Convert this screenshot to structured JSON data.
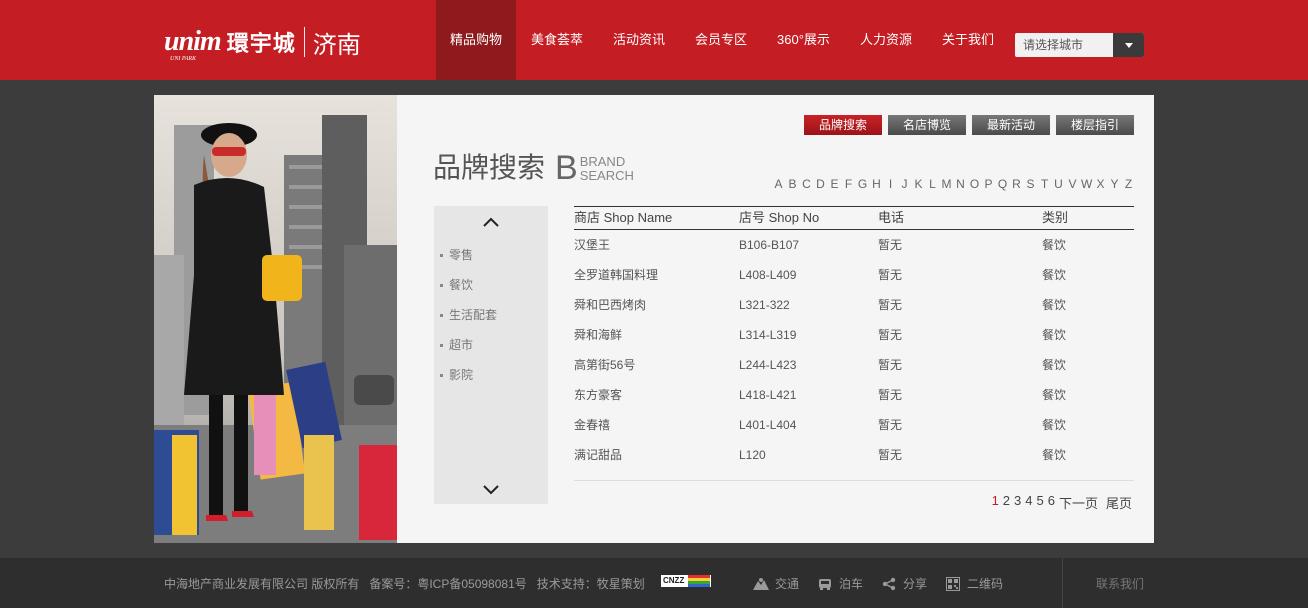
{
  "header": {
    "logo_mark": "unim",
    "logo_sub": "UNI PARK",
    "logo_brand": "環宇城",
    "logo_city": "济南",
    "nav": [
      "精品购物",
      "美食荟萃",
      "活动资讯",
      "会员专区",
      "360°展示",
      "人力资源",
      "关于我们"
    ],
    "active_nav": "精品购物",
    "city_placeholder": "请选择城市"
  },
  "tabs": [
    "品牌搜索",
    "名店博览",
    "最新活动",
    "楼层指引"
  ],
  "title": {
    "cn": "品牌搜索",
    "b": "B",
    "en_line1": "BRAND",
    "en_line2": "SEARCH"
  },
  "alphabet": [
    "A",
    "B",
    "C",
    "D",
    "E",
    "F",
    "G",
    "H",
    "I",
    "J",
    "K",
    "L",
    "M",
    "N",
    "O",
    "P",
    "Q",
    "R",
    "S",
    "T",
    "U",
    "V",
    "W",
    "X",
    "Y",
    "Z"
  ],
  "categories": [
    "零售",
    "餐饮",
    "生活配套",
    "超市",
    "影院"
  ],
  "table": {
    "headers": [
      "商店 Shop Name",
      "店号 Shop No",
      "电话",
      "类别"
    ],
    "rows": [
      [
        "汉堡王",
        "B106-B107",
        "暂无",
        "餐饮"
      ],
      [
        "全罗道韩国料理",
        "L408-L409",
        "暂无",
        "餐饮"
      ],
      [
        "舜和巴西烤肉",
        "L321-322",
        "暂无",
        "餐饮"
      ],
      [
        "舜和海鲜",
        "L314-L319",
        "暂无",
        "餐饮"
      ],
      [
        "高第街56号",
        "L244-L423",
        "暂无",
        "餐饮"
      ],
      [
        "东方豪客",
        "L418-L421",
        "暂无",
        "餐饮"
      ],
      [
        "金春禧",
        "L401-L404",
        "暂无",
        "餐饮"
      ],
      [
        "满记甜品",
        "L120",
        "暂无",
        "餐饮"
      ]
    ]
  },
  "pager": {
    "pages": [
      "1",
      "2",
      "3",
      "4",
      "5",
      "6"
    ],
    "current": "1",
    "next": "下一页",
    "last": "尾页"
  },
  "footer": {
    "company": "中海地产商业发展有限公司 版权所有",
    "icp": "备案号：粤ICP备05098081号",
    "tech": "技术支持：牧星策划",
    "cnzz": "CNZZ",
    "links": [
      "交通",
      "泊车",
      "分享",
      "二维码"
    ],
    "contact": "联系我们"
  },
  "colors": {
    "brand_red": "#c41e24",
    "nav_active": "#8f1a1d",
    "footer_bg": "#2e2e2e",
    "page_bg": "#3c3c3c"
  }
}
